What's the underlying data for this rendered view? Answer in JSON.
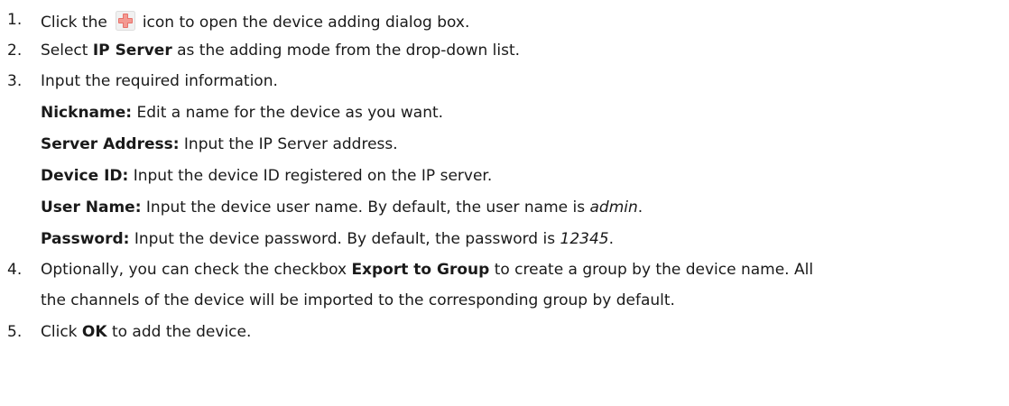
{
  "icons": {
    "add": "add-device-plus-icon",
    "add_color": "#e8716a"
  },
  "steps": [
    {
      "num": "1.",
      "pre": "Click the",
      "post": "icon to open the device adding dialog box."
    },
    {
      "num": "2.",
      "pre": "Select ",
      "bold": "IP Server",
      "post": " as the adding mode from the drop-down list."
    },
    {
      "num": "3.",
      "text": "Input the required information."
    },
    {
      "num": "4.",
      "pre": "Optionally, you can check the checkbox ",
      "bold": "Export to Group",
      "post": " to create a group by the device name. All",
      "line2": "the channels of the device will be imported to the corresponding group by default."
    },
    {
      "num": "5.",
      "pre": "Click ",
      "bold": "OK",
      "post": " to add the device."
    }
  ],
  "fields": [
    {
      "label": "Nickname:",
      "desc": " Edit a name for the device as you want."
    },
    {
      "label": "Server Address:",
      "desc": " Input the IP Server address."
    },
    {
      "label": "Device ID:",
      "desc": " Input the device ID registered on the IP server."
    },
    {
      "label": "User Name:",
      "desc": " Input the device user name. By default, the user name is ",
      "value": "admin",
      "end": "."
    },
    {
      "label": "Password:",
      "desc": " Input the device password. By default, the password is ",
      "value": "12345",
      "end": "."
    }
  ]
}
